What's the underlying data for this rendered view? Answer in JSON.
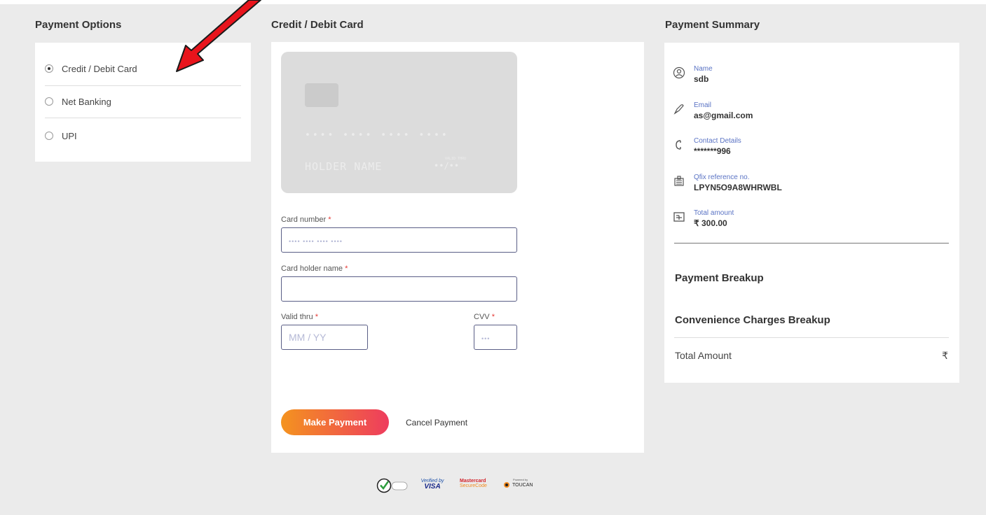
{
  "payment_options": {
    "title": "Payment Options",
    "options": [
      {
        "label": "Credit / Debit Card",
        "selected": true
      },
      {
        "label": "Net Banking",
        "selected": false
      },
      {
        "label": "UPI",
        "selected": false
      }
    ]
  },
  "card_section": {
    "title": "Credit / Debit Card",
    "preview": {
      "number_mask": "•••• •••• •••• ••••",
      "holder_placeholder": "HOLDER NAME",
      "valid_caption": "VALID THRU",
      "expiry_mask": "••/••"
    },
    "fields": {
      "card_number": {
        "label": "Card number",
        "required_mark": "*",
        "placeholder": "•••• •••• •••• ••••"
      },
      "holder_name": {
        "label": "Card holder name",
        "required_mark": "*",
        "placeholder": ""
      },
      "valid_thru": {
        "label": "Valid thru",
        "required_mark": "*",
        "placeholder": "MM / YY"
      },
      "cvv": {
        "label": "CVV",
        "required_mark": "*",
        "placeholder": "•••"
      }
    },
    "make_payment_label": "Make Payment",
    "cancel_payment_label": "Cancel Payment"
  },
  "summary": {
    "title": "Payment Summary",
    "rows": [
      {
        "icon": "user-icon",
        "label": "Name",
        "value": "sdb"
      },
      {
        "icon": "email-icon",
        "label": "Email",
        "value": "as@gmail.com"
      },
      {
        "icon": "phone-icon",
        "label": "Contact Details",
        "value": "*******996"
      },
      {
        "icon": "reference-icon",
        "label": "Qfix reference no.",
        "value": "LPYN5O9A8WHRWBL"
      },
      {
        "icon": "amount-icon",
        "label": "Total amount",
        "value": "₹ 300.00"
      }
    ],
    "payment_breakup_heading": "Payment Breakup",
    "convenience_heading": "Convenience Charges Breakup",
    "total_label": "Total Amount",
    "total_currency": "₹"
  },
  "badges": {
    "norton": "Norton Secured",
    "visa_top": "Verified by",
    "visa_bottom": "VISA",
    "mastercard_top": "Mastercard",
    "mastercard_bottom": "SecureCode",
    "toucan_top": "Powered by",
    "toucan_bottom": "TOUCAN"
  },
  "colors": {
    "accent_start": "#f4931f",
    "accent_end": "#ee3c5e",
    "label_blue": "#5a73c4",
    "input_border": "#5a5e86",
    "arrow_red": "#e8141c"
  }
}
